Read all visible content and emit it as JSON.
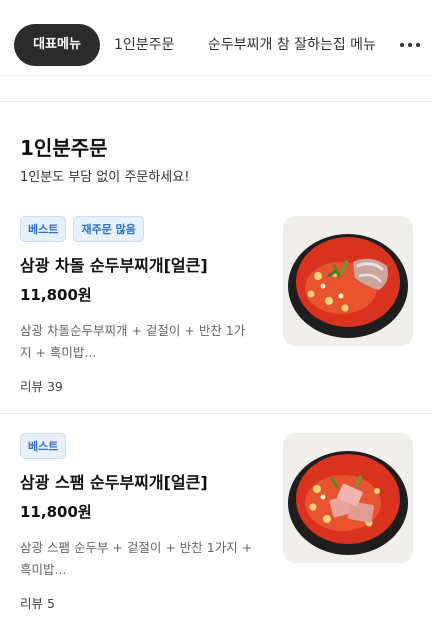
{
  "tabs": [
    {
      "label": "대표메뉴",
      "active": true
    },
    {
      "label": "1인분주문",
      "active": false
    },
    {
      "label": "순두부찌개 참 잘하는집 메뉴",
      "active": false
    }
  ],
  "more_icon": "more-horizontal-icon",
  "section": {
    "title": "1인분주문",
    "subtitle": "1인분도 부담 없이 주문하세요!"
  },
  "items": [
    {
      "badges": [
        "베스트",
        "재주문 많음"
      ],
      "name": "삼광 차돌 순두부찌개[얼큰]",
      "price": "11,800원",
      "description": "삼광 차돌순두부찌개 + 겉절이 + 반찬 1가지 + 흑미밥...",
      "review": "리뷰 39"
    },
    {
      "badges": [
        "베스트"
      ],
      "name": "삼광 스팸 순두부찌개[얼큰]",
      "price": "11,800원",
      "description": "삼광 스팸 순두부 + 겉절이 + 반찬 1가지 + 흑미밥...",
      "review": "리뷰 5"
    }
  ],
  "colors": {
    "active_tab_bg": "#2b2b2b",
    "badge_text": "#2f6fc4",
    "badge_bg": "#e7f0fb",
    "stew_red": "#d9331f"
  }
}
